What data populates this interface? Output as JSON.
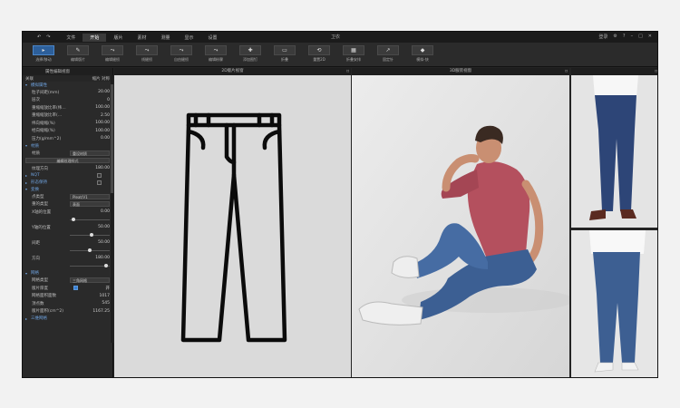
{
  "titlebar": {
    "back": "↶",
    "forward": "↷",
    "menu": [
      "文件",
      "开始",
      "版片",
      "素材",
      "测量",
      "显示",
      "设置"
    ],
    "active_menu": "开始",
    "app_title": "卫衣",
    "login": "登录",
    "icons": [
      "settings-icon",
      "help-icon",
      "minimize-icon",
      "maximize-icon",
      "close-icon"
    ]
  },
  "toolbar": {
    "tools": [
      {
        "label": "选择/移动",
        "icon": "▸",
        "active": true
      },
      {
        "label": "编辑版片",
        "icon": "✎"
      },
      {
        "label": "编辑缝纫",
        "icon": "⤳"
      },
      {
        "label": "线缝纫",
        "icon": "⤳"
      },
      {
        "label": "自由缝纫",
        "icon": "⤳"
      },
      {
        "label": "编辑粉骤",
        "icon": "⤳"
      },
      {
        "label": "添加图钉",
        "icon": "✚"
      },
      {
        "label": "折叠",
        "icon": "▭"
      },
      {
        "label": "重置2D",
        "icon": "⟲"
      },
      {
        "label": "折叠安排",
        "icon": "▦"
      },
      {
        "label": "固定针",
        "icon": "↗"
      },
      {
        "label": "模拟-快",
        "icon": "◆"
      }
    ]
  },
  "sidebar": {
    "header_title": "属性编辑视窗",
    "tab_left": "关联",
    "tab_right": "缩片 对称",
    "sections": {
      "fabric_props": "模拟属性",
      "material": "材质",
      "nqt": "NQT",
      "shape_preserve": "形态保持",
      "transform": "变换",
      "mesh": "网格",
      "triangle_mesh": "三维网格"
    },
    "sim_rows": [
      {
        "label": "粒子间距(mm)",
        "value": "20.00"
      },
      {
        "label": "层次",
        "value": "0"
      },
      {
        "label": "重缩缩放比率(纬…",
        "value": "100.00"
      },
      {
        "label": "重缩缩放比率(…",
        "value": "2.50"
      },
      {
        "label": "纬向缩缩(%)",
        "value": "100.00"
      },
      {
        "label": "经向缩缩(%)",
        "value": "100.00"
      },
      {
        "label": "压力(g/mm^2)",
        "value": "0.00"
      }
    ],
    "material_row": {
      "label": "材质",
      "value": "重设材质"
    },
    "edit_button": "编辑纹理样式",
    "grain_row": {
      "label": "纹理方向",
      "value": "180.00"
    },
    "transform_rows": [
      {
        "label": "点类型",
        "value": "Pleat/V1"
      },
      {
        "label": "重的类型",
        "value": "表面"
      },
      {
        "label": "X轴的位置",
        "value": "0.00"
      },
      {
        "label": "Y轴的位置",
        "value": "50.00"
      },
      {
        "label": "间距",
        "value": "50.00"
      },
      {
        "label": "方向",
        "value": "180.00"
      }
    ],
    "transform_sliders": [
      0.05,
      0.55,
      0.5,
      0.95
    ],
    "mesh_rows": [
      {
        "label": "网格类型",
        "value": "三角网格"
      },
      {
        "label": "版片厚度",
        "value": "开"
      },
      {
        "label": "网格面积面数",
        "value": "1017"
      },
      {
        "label": "顶点数",
        "value": "545"
      },
      {
        "label": "版片面积(cm^2)",
        "value": "1167.25"
      }
    ]
  },
  "views": {
    "view2d_title": "2D版片视窗",
    "view3d_title": "3D服装视窗",
    "corner_icon": "⌑"
  },
  "colors": {
    "accent_blue": "#3a7fd4",
    "panel_dark": "#242424",
    "shirt_red": "#b4505e",
    "denim": "#3c5f93"
  }
}
